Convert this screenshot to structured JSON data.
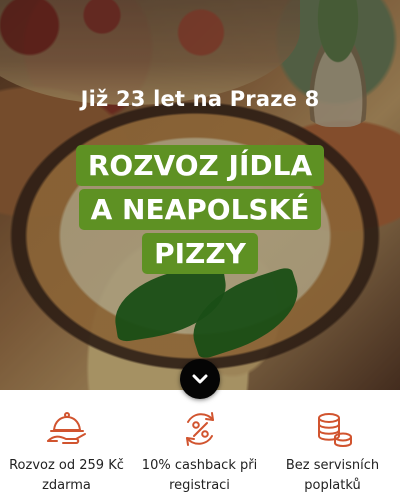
{
  "hero": {
    "subtitle": "Již 23 let na Praze 8",
    "title_lines": [
      "ROZVOZ JÍDLA",
      "A NEAPOLSKÉ",
      "PIZZY"
    ]
  },
  "scroll": {
    "icon": "chevron-down-icon"
  },
  "benefits": [
    {
      "icon": "food-delivery-icon",
      "text": "Rozvoz od 259 Kč\nzdarma"
    },
    {
      "icon": "cashback-icon",
      "text": "10% cashback při\nregistraci"
    },
    {
      "icon": "coins-icon",
      "text": "Bez servisních\npoplatků"
    }
  ],
  "colors": {
    "accent_green": "#5e9123",
    "icon_accent": "#d1542f"
  }
}
